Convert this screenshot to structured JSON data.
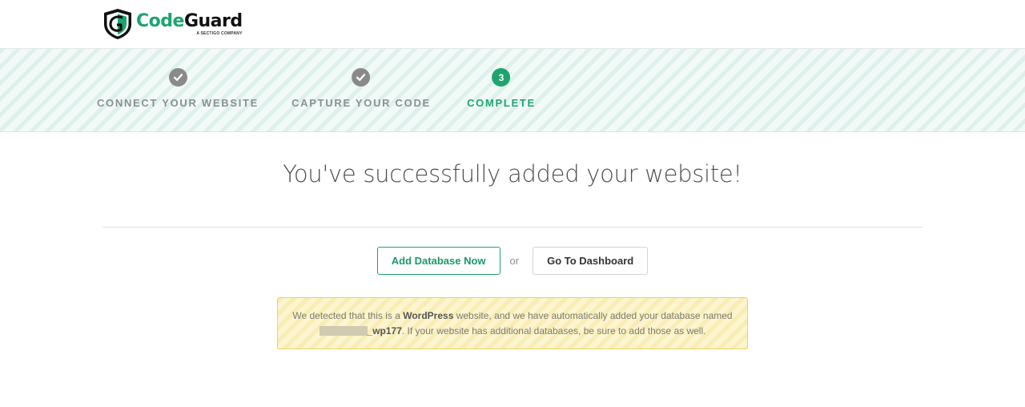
{
  "brand": {
    "name_part1": "Code",
    "name_part2": "Guard",
    "tagline": "A SECTIGO COMPANY",
    "green": "#1ea46e"
  },
  "steps": [
    {
      "number": "1",
      "label": "CONNECT YOUR WEBSITE",
      "status": "done",
      "icon": "check-icon"
    },
    {
      "number": "2",
      "label": "CAPTURE YOUR CODE",
      "status": "done",
      "icon": "check-icon"
    },
    {
      "number": "3",
      "label": "COMPLETE",
      "status": "active"
    }
  ],
  "main": {
    "title": "You've successfully added your website!",
    "add_db_label": "Add Database Now",
    "or_label": "or",
    "dashboard_label": "Go To Dashboard"
  },
  "notice": {
    "p1": "We detected that this is a ",
    "platform": "WordPress",
    "p2": " website, and we have automatically added your database named",
    "db_suffix": "_wp177",
    "p3": ". If your website has additional databases, be sure to add those as well."
  }
}
